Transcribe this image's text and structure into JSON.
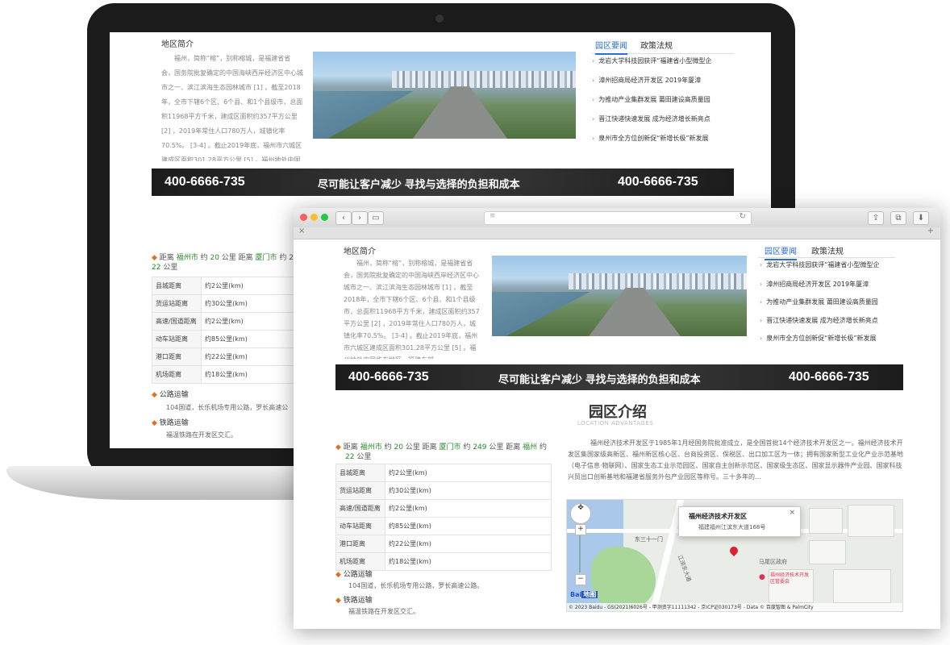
{
  "site": {
    "about_title": "地区简介",
    "about_text": "福州，简称“榕”，别称榕城，是福建省省会，国务院批复确定的中国海峡西岸经济区中心城市之一、滨江滨海生态园林城市 [1] 。截至2018年，全市下辖6个区、6个县、和1个县级市，总面积11968平方千米，建成区面积约357平方公里 [2] ，2019年常住人口780万人，城镇化率70.5%。 [3-4] 。截止2019年底，福州市六城区建成区面积301.28平方公里 [5] 。福州地处中国华东地区、福建东部、",
    "tabs": [
      "园区要闻",
      "政策法规"
    ],
    "news": [
      "龙岩大学科技园获评“福建省小型微型企",
      "漳州招商局经济开发区 2019年厦漳",
      "为推动产业集群发展 莆田建设高质量园",
      "晋江快递快速发展 成为经济增长新亮点",
      "泉州市全方位创新促“新增长极”新发展"
    ],
    "banner": {
      "phone_left": "400-6666-735",
      "slogan": "尽可能让客户减少   寻找与选择的负担和成本",
      "phone_right": "400-6666-735"
    },
    "park_title": "园区介绍",
    "park_subtitle": "LOCATION ADVANTAGES",
    "park_text": "福州经济技术开发区于1985年1月经国务院批准成立，是全国首批14个经济技术开发区之一。福州经济技术开发区集国家级高新区、福州新区核心区、台商投资区、保税区、出口加工区为一体；拥有国家新型工业化产业示范基地（电子信息·物联网）、国家生态工业示范园区、国家自主创新示范区、国家级生态区、国家显示器件产业园、国家科技兴贸出口创新基地和福建省服务外包产业园区等称号。三十多年的...",
    "distance": {
      "p1": "距离",
      "c1": "福州市",
      "p2": "约",
      "n1": "20",
      "p3": "公里   距离",
      "c2": "厦门市",
      "p4": "约",
      "n2": "249",
      "p5": "公里   距离",
      "c3": "福州",
      "p6": "约",
      "n3": "22",
      "p7": "公里"
    },
    "distance_short": {
      "p1": "距离",
      "c1": "福州市",
      "p2": "约",
      "n1": "20",
      "p3": "公里   距离",
      "c2": "厦门市",
      "p4": "约 2",
      "n3": "22",
      "p7": "公里"
    },
    "table": [
      [
        "县城距离",
        "约2公里(km)"
      ],
      [
        "货运站距离",
        "约30公里(km)"
      ],
      [
        "高速/国道距离",
        "约2公里(km)"
      ],
      [
        "动车站距离",
        "约85公里(km)"
      ],
      [
        "港口距离",
        "约22公里(km)"
      ],
      [
        "机场距离",
        "约18公里(km)"
      ]
    ],
    "road_title": "公路运输",
    "road_text": "104国道，长乐机场专用公路，罗长高速公路。",
    "road_text_cut": "104国道，长乐机场专用公路，罗长高速公",
    "rail_title": "铁路运输",
    "rail_text": "福温铁路在开发区交汇。",
    "map": {
      "popup_title": "福州经济技术开发区",
      "popup_addr": "福建福州江滨东大道168号",
      "label_gate": "东三十一门",
      "label_road": "江滨东大道",
      "label_gov": "马尾区政府",
      "label_poi": "福州经济技术开发区管委会",
      "copyright": "© 2023 Baidu - GS(2021)6026号 - 甲测资字11111342 - 京ICP证030173号 - Data © 百度智图 & PalmCity",
      "logo_text": "Bai",
      "logo_text2": "地图"
    }
  },
  "browser": {
    "tab_close": "×",
    "new_tab": "+"
  },
  "colors": {
    "tab_active": "#2a6fd6",
    "city_link": "#2c8a2c",
    "bullet": "#e07020",
    "pin": "#dd2233"
  }
}
